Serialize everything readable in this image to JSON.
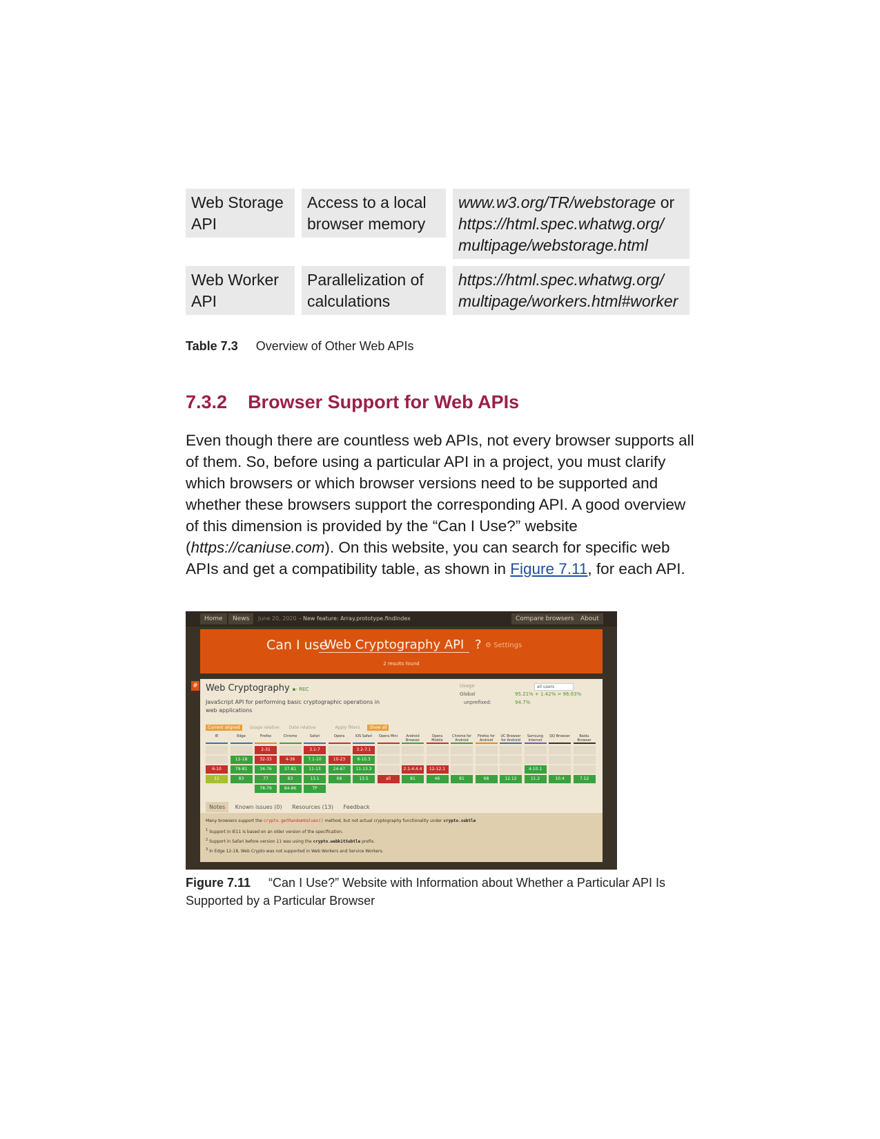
{
  "table": {
    "rows": [
      {
        "name": "Web Storage API",
        "description": "Access to a local browser memory",
        "ref_main": "www.w3.org/TR/webstorage",
        "ref_join": " or",
        "ref_rest": "https://html.spec.whatwg.org/ multipage/webstorage.html"
      },
      {
        "name": "Web Worker API",
        "description": "Parallelization of calculations",
        "ref_main": "https://html.spec.whatwg.org/ multipage/workers.html#worker",
        "ref_join": "",
        "ref_rest": ""
      }
    ],
    "caption_label": "Table 7.3",
    "caption_text": "Overview of Other Web APIs"
  },
  "section": {
    "number": "7.3.2",
    "title": "Browser Support for Web APIs"
  },
  "paragraph": {
    "part1": "Even though there are countless web APIs, not every browser supports all of them. So, before using a particular API in a project, you must clarify which browsers or which browser versions need to be supported and whether these browsers support the corresponding API. A good overview of this dimension is provided by the “Can I Use?” website (",
    "url": "https://caniuse.com",
    "part2": "). On this website, you can search for specific web APIs and get a compatibility table, as shown in ",
    "link": "Figure 7.11",
    "part3": ", for each API."
  },
  "figure": {
    "caption_label": "Figure 7.11",
    "caption_text": "“Can I Use?” Website with Information about Whether a Particular API Is Supported by a Particular Browser"
  },
  "shot": {
    "nav": {
      "home": "Home",
      "news": "News",
      "news_date": "June 20, 2020",
      "news_text": "- New feature: Array.prototype.findIndex",
      "compare": "Compare browsers",
      "about": "About"
    },
    "search": {
      "prefix": "Can I use",
      "query": "Web Cryptography API",
      "qmark": "?",
      "settings": "Settings",
      "results": "2 results found"
    },
    "feature": {
      "hash": "#",
      "title": "Web Cryptography",
      "status": "- REC",
      "description": "JavaScript API for performing basic cryptographic operations in web applications",
      "usage_label": "Usage",
      "usage_select": "all users",
      "global_label": "Global",
      "global_value": "95.21% + 1.42% = 96.63%",
      "unprefixed_label": "unprefixed:",
      "unprefixed_value": "94.7%"
    },
    "options": [
      "Current aligned",
      "Usage relative",
      "Date relative",
      "Apply filters",
      "Show all"
    ],
    "browsers": [
      {
        "name": "IE",
        "line": "#3a6fb5",
        "cells": [
          "",
          "",
          "6-10",
          "11"
        ]
      },
      {
        "name": "Edge",
        "line": "#3a6fb5",
        "cells": [
          "",
          "12-18",
          "79-81",
          "83"
        ]
      },
      {
        "name": "Firefox",
        "line": "#e08a1e",
        "cells": [
          "2-31",
          "32-33",
          "34-76",
          "77",
          "78-79"
        ]
      },
      {
        "name": "Chrome",
        "line": "#39a13d",
        "cells": [
          "",
          "4-36",
          "37-81",
          "83",
          "84-86"
        ]
      },
      {
        "name": "Safari",
        "line": "#3a6fb5",
        "cells": [
          "3.1-7",
          "7.1-10",
          "11-13",
          "13.1",
          "TP"
        ]
      },
      {
        "name": "Opera",
        "line": "#c4302b",
        "cells": [
          "",
          "10-23",
          "24-67",
          "68"
        ]
      },
      {
        "name": "iOS Safari",
        "line": "#3a6fb5",
        "cells": [
          "3.2-7.1",
          "8-10.3",
          "11-13.3",
          "13.5"
        ]
      },
      {
        "name": "Opera Mini",
        "line": "#c4302b",
        "cells": [
          "",
          "",
          "",
          "all"
        ]
      },
      {
        "name": "Android Browser",
        "line": "#39a13d",
        "cells": [
          "",
          "",
          "2.1-4.4.4",
          "81"
        ]
      },
      {
        "name": "Opera Mobile",
        "line": "#c4302b",
        "cells": [
          "",
          "",
          "12-12.1",
          "46"
        ]
      },
      {
        "name": "Chrome for Android",
        "line": "#39a13d",
        "cells": [
          "",
          "",
          "",
          "81"
        ]
      },
      {
        "name": "Firefox for Android",
        "line": "#e08a1e",
        "cells": [
          "",
          "",
          "",
          "68"
        ]
      },
      {
        "name": "UC Browser for Android",
        "line": "#3a6fb5",
        "cells": [
          "",
          "",
          "",
          "12.12"
        ]
      },
      {
        "name": "Samsung Internet",
        "line": "#7b4fb5",
        "cells": [
          "",
          "",
          "4-10.1",
          "11.2"
        ]
      },
      {
        "name": "QQ Browser",
        "line": "#333333",
        "cells": [
          "",
          "",
          "",
          "10.4"
        ]
      },
      {
        "name": "Baidu Browser",
        "line": "#333333",
        "cells": [
          "",
          "",
          "",
          "7.12"
        ]
      }
    ],
    "tabs": [
      "Notes",
      "Known issues (0)",
      "Resources (13)",
      "Feedback"
    ],
    "notes": {
      "line1_a": "Many browsers support the ",
      "line1_code": "crypto.getRandomValues()",
      "line1_b": " method, but not actual cryptography functionality under ",
      "line1_k": "crypto.subtle",
      "line2": "Support in IE11 is based on an older version of the specification.",
      "line3_a": "Support in Safari before version 11 was using the ",
      "line3_k": "crypto.webkitSubtle",
      "line3_b": " prefix.",
      "line4": "In Edge 12-18, Web Crypto was not supported in Web Workers and Service Workers.",
      "marks": [
        "1",
        "2",
        "3"
      ]
    }
  }
}
